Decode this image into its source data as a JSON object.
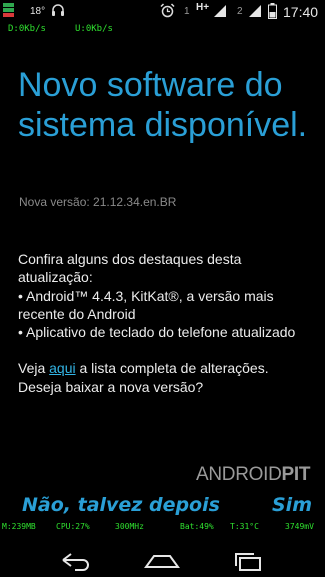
{
  "status_bar": {
    "temperature": "18°",
    "sim1_label": "1",
    "network_type": "H+",
    "sim2_label": "2",
    "time": "17:40",
    "flag_colors": [
      "#2fa84f",
      "#2fa84f",
      "#d83a3a"
    ],
    "icons": [
      "flag-icon",
      "headphones-icon",
      "alarm-icon",
      "signal-icon",
      "battery-icon"
    ]
  },
  "network_speed": {
    "download": "D:0Kb/s",
    "upload": "U:0Kb/s"
  },
  "update": {
    "title": "Novo software do sistema disponível.",
    "version": "Nova versão: 21.12.34.en.BR",
    "highlights_intro": "Confira alguns dos destaques desta atualização:",
    "bullets": [
      "• Android™ 4.4.3, KitKat®, a versão mais recente do Android",
      "• Aplicativo de teclado do telefone atualizado"
    ],
    "link_prefix": "Veja ",
    "link_text": "aqui",
    "link_suffix": " a lista completa de alterações.",
    "question": "Deseja baixar a nova versão?"
  },
  "watermark": {
    "part1": "ANDROID",
    "part2": "PIT"
  },
  "buttons": {
    "decline": "Não, talvez depois",
    "accept": "Sim"
  },
  "system_monitor": {
    "memory": "M:239MB",
    "cpu": "CPU:27%",
    "frequency": "300MHz",
    "battery": "Bat:49%",
    "temperature": "T:31°C",
    "voltage": "3749mV"
  },
  "accent_color": "#2a9fd6",
  "text_color": "#ececec"
}
